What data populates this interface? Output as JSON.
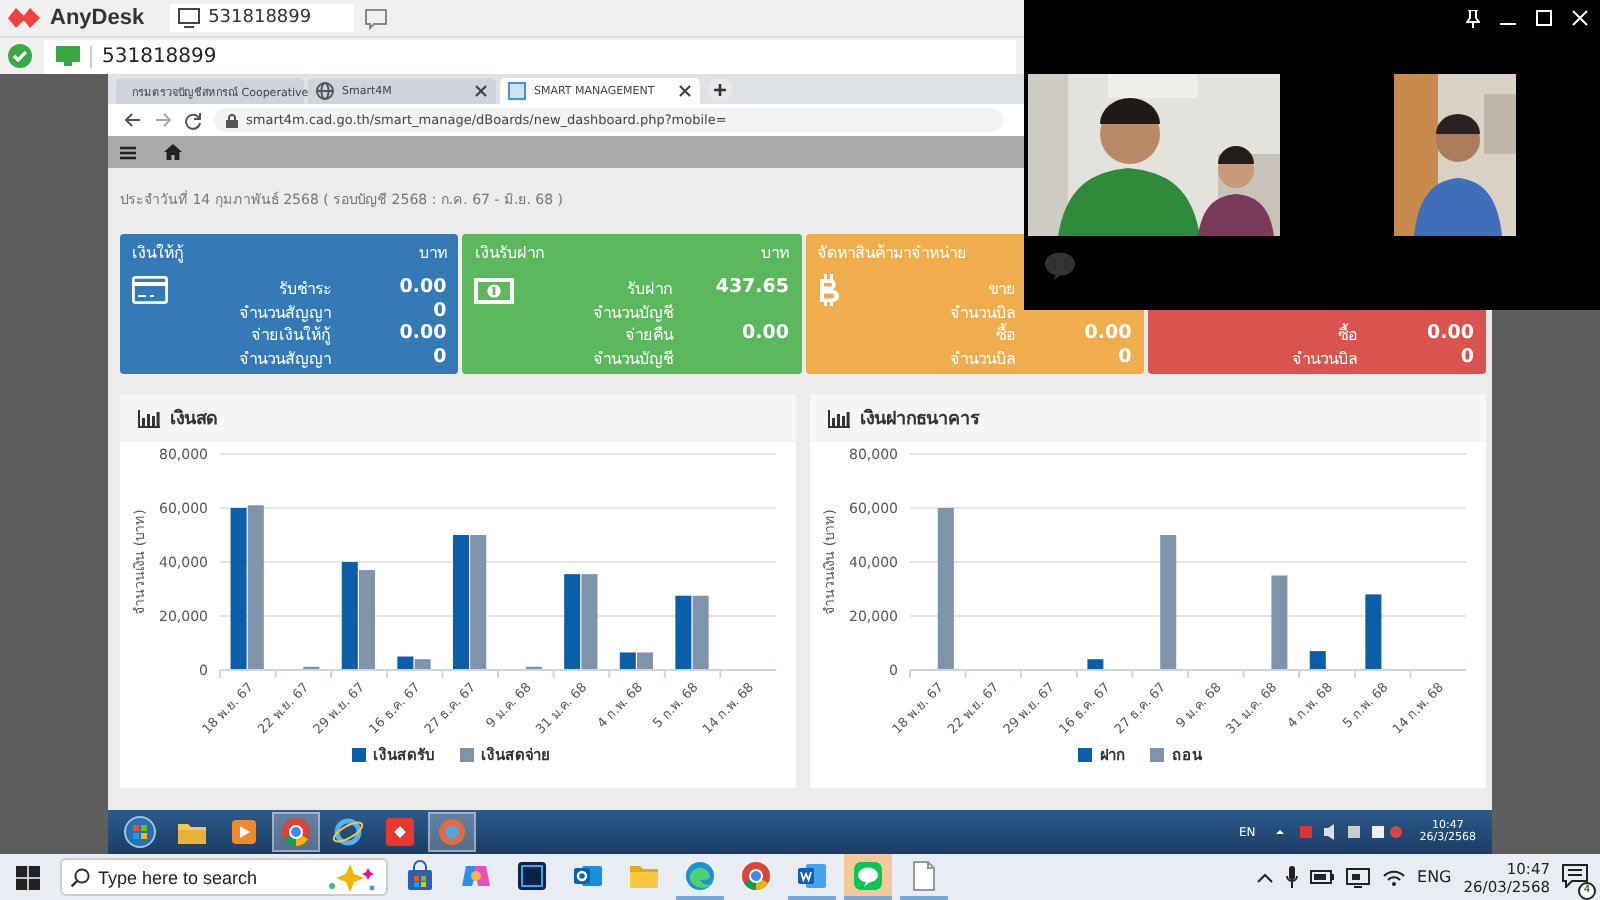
{
  "anydesk": {
    "app_name": "AnyDesk",
    "address_tab": "531818899",
    "session_id": "531818899"
  },
  "browser": {
    "tabs": [
      {
        "label": "กรมตรวจบัญชีสหกรณ์ Cooperative",
        "kind": "globe",
        "selected": false
      },
      {
        "label": "Smart4M",
        "kind": "globe",
        "selected": false
      },
      {
        "label": "SMART MANAGEMENT",
        "kind": "site",
        "selected": true
      }
    ],
    "url": "smart4m.cad.go.th/smart_manage/dBoards/new_dashboard.php?mobile=",
    "date_line": "ประจำวันที่ 14 กุมภาพันธ์ 2568 ( รอบบัญชี 2568 : ก.ค. 67 - มิ.ย. 68 )",
    "cards": [
      {
        "title": "เงินให้กู้",
        "unit": "บาท",
        "color": "#337ab7",
        "kind": "card",
        "rows": [
          {
            "label": "รับชำระ",
            "value": "0.00"
          },
          {
            "label": "จำนวนสัญญา",
            "value": "0"
          },
          {
            "label": "จ่ายเงินให้กู้",
            "value": "0.00"
          },
          {
            "label": "จำนวนสัญญา",
            "value": "0"
          }
        ]
      },
      {
        "title": "เงินรับฝาก",
        "unit": "บาท",
        "color": "#5cb85c",
        "kind": "cash",
        "rows": [
          {
            "label": "รับฝาก",
            "value": "437.65"
          },
          {
            "label": "จำนวนบัญชี"
          },
          {
            "label": "จ่ายคืน",
            "value": "0.00"
          },
          {
            "label": "จำนวนบัญชี"
          }
        ]
      },
      {
        "title": "จัดหาสินค้ามาจำหน่าย",
        "color": "#f0ad4e",
        "kind": "coin",
        "rows": [
          {
            "label": "ขาย"
          },
          {
            "label": "จำนวนบิล"
          },
          {
            "label": "ซื้อ",
            "value": "0.00"
          },
          {
            "label": "จำนวนบิล",
            "value": "0"
          }
        ]
      },
      {
        "color": "#d9534f",
        "rows": [
          {
            "label": "ซื้อ",
            "value": "0.00"
          },
          {
            "label": "จำนวนบิล",
            "value": "0"
          }
        ]
      }
    ],
    "panels": [
      {
        "title": "เงินสด",
        "chart_data": {
          "type": "bar",
          "grid": true,
          "legend": true,
          "ylabel": "จำนวนเงิน (บาท)",
          "categories": [
            "18 พ.ย. 67",
            "22 พ.ย. 67",
            "29 พ.ย. 67",
            "16 ธ.ค. 67",
            "27 ธ.ค. 67",
            "9 ม.ค. 68",
            "31 ม.ค. 68",
            "4 ก.พ. 68",
            "5 ก.พ. 68",
            "14 ก.พ. 68"
          ],
          "ylim": [
            0,
            80000
          ],
          "yticks": [
            {
              "value": 0,
              "label": "0"
            },
            {
              "value": 20000,
              "label": "20,000"
            },
            {
              "value": 40000,
              "label": "40,000"
            },
            {
              "value": 60000,
              "label": "60,000"
            },
            {
              "value": 80000,
              "label": "80,000"
            }
          ],
          "series": [
            {
              "name": "เงินสดรับ",
              "color": "#0b5ea8",
              "values": [
                60000,
                0,
                40000,
                5000,
                50000,
                0,
                35500,
                6500,
                27500,
                0
              ]
            },
            {
              "name": "เงินสดจ่าย",
              "color": "#7f93aa",
              "values": [
                61000,
                1200,
                37000,
                4000,
                50000,
                1200,
                35500,
                6500,
                27500,
                0
              ]
            }
          ]
        }
      },
      {
        "title": "เงินฝากธนาคาร",
        "chart_data": {
          "type": "bar",
          "grid": true,
          "legend": true,
          "ylabel": "จำนวนเงิน (บาท)",
          "categories": [
            "18 พ.ย. 67",
            "22 พ.ย. 67",
            "29 พ.ย. 67",
            "16 ธ.ค. 67",
            "27 ธ.ค. 67",
            "9 ม.ค. 68",
            "31 ม.ค. 68",
            "4 ก.พ. 68",
            "5 ก.พ. 68",
            "14 ก.พ. 68"
          ],
          "ylim": [
            0,
            80000
          ],
          "yticks": [
            {
              "value": 0,
              "label": "0"
            },
            {
              "value": 20000,
              "label": "20,000"
            },
            {
              "value": 40000,
              "label": "40,000"
            },
            {
              "value": 60000,
              "label": "60,000"
            },
            {
              "value": 80000,
              "label": "80,000"
            }
          ],
          "series": [
            {
              "name": "ฝาก",
              "color": "#0b5ea8",
              "values": [
                0,
                0,
                0,
                4000,
                0,
                0,
                0,
                7000,
                28000,
                0
              ]
            },
            {
              "name": "ถอน",
              "color": "#7f93aa",
              "values": [
                60000,
                0,
                0,
                0,
                50000,
                0,
                35000,
                0,
                0,
                0
              ]
            }
          ]
        }
      }
    ]
  },
  "remote_taskbar": {
    "apps": [
      {
        "kind": "start",
        "active": false
      },
      {
        "kind": "folder",
        "active": false
      },
      {
        "kind": "media",
        "active": false
      },
      {
        "kind": "chrome",
        "active": true
      },
      {
        "kind": "ie",
        "active": false
      },
      {
        "kind": "remote",
        "active": false
      },
      {
        "kind": "app",
        "active": true
      }
    ],
    "language": "EN",
    "time": "10:47",
    "date": "26/3/2568"
  },
  "local_taskbar": {
    "search_placeholder": "Type here to search",
    "apps": [
      {
        "kind": "store",
        "active": false,
        "running": false
      },
      {
        "kind": "copilot",
        "active": false,
        "running": false
      },
      {
        "kind": "ps",
        "active": false,
        "running": false
      },
      {
        "kind": "mail",
        "active": false,
        "running": false
      },
      {
        "kind": "folder",
        "active": false,
        "running": false
      },
      {
        "kind": "edge",
        "active": false,
        "running": true
      },
      {
        "kind": "chrome",
        "active": false,
        "running": false
      },
      {
        "kind": "word",
        "active": false,
        "running": true
      },
      {
        "kind": "line",
        "active": true,
        "running": true
      },
      {
        "kind": "file",
        "active": false,
        "running": true
      }
    ],
    "language": "ENG",
    "time": "10:47",
    "date": "26/03/2568",
    "notifications": "4"
  }
}
